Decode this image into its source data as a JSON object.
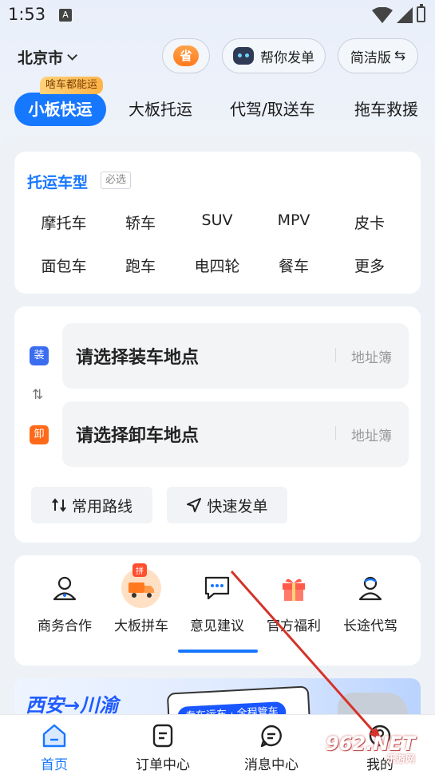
{
  "status_bar": {
    "time": "1:53",
    "notif_icon": "A"
  },
  "header": {
    "city": "北京市",
    "save_badge": "省",
    "help_label": "帮你发单",
    "simple_label": "简洁版",
    "simple_icon": "⇆"
  },
  "tabs": {
    "badge": "啥车都能运",
    "items": [
      {
        "label": "小板快运"
      },
      {
        "label": "大板托运"
      },
      {
        "label": "代驾/取送车"
      },
      {
        "label": "拖车救援"
      }
    ]
  },
  "vehicle": {
    "title": "托运车型",
    "required": "必选",
    "types": [
      "摩托车",
      "轿车",
      "SUV",
      "MPV",
      "皮卡",
      "面包车",
      "跑车",
      "电四轮",
      "餐车",
      "更多"
    ]
  },
  "route": {
    "load_tag": "装",
    "load_placeholder": "请选择装车地点",
    "unload_tag": "卸",
    "unload_placeholder": "请选择卸车地点",
    "address_book": "地址簿",
    "swap_icon": "⇅",
    "common_routes": "常用路线",
    "quick_order": "快速发单"
  },
  "quick": {
    "items": [
      {
        "label": "商务合作",
        "icon": "person-icon"
      },
      {
        "label": "大板拼车",
        "icon": "truck-icon",
        "badge": "拼"
      },
      {
        "label": "意见建议",
        "icon": "chat-icon"
      },
      {
        "label": "官方福利",
        "icon": "gift-icon"
      },
      {
        "label": "长途代驾",
        "icon": "driver-icon"
      }
    ]
  },
  "banner": {
    "title": "西安→川渝",
    "pill": "专车运车 · 全程管车"
  },
  "nav": {
    "items": [
      {
        "label": "首页",
        "active": true
      },
      {
        "label": "订单中心"
      },
      {
        "label": "消息中心"
      },
      {
        "label": "我的"
      }
    ]
  },
  "watermark": {
    "main": "962.NET",
    "sub": "乐游网"
  },
  "colors": {
    "primary": "#1677ff",
    "accent_orange": "#ff7a1f",
    "annotation_arrow": "#d6322a"
  }
}
